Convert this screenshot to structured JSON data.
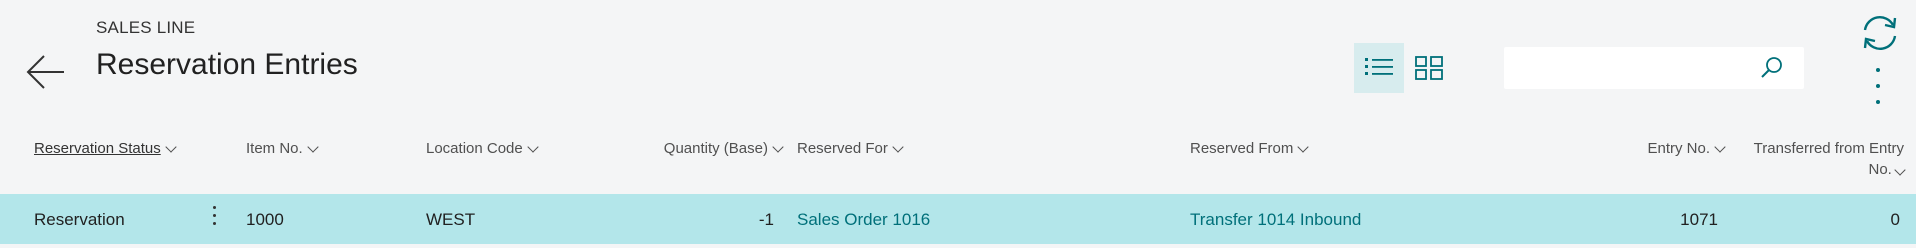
{
  "header": {
    "caption": "SALES LINE",
    "title": "Reservation Entries"
  },
  "search": {
    "value": "",
    "placeholder": ""
  },
  "columns": [
    {
      "label": "Reservation Status"
    },
    {
      "label": "Item No."
    },
    {
      "label": "Location Code"
    },
    {
      "label": "Quantity (Base)"
    },
    {
      "label": "Reserved For"
    },
    {
      "label": "Reserved From"
    },
    {
      "label": "Entry No."
    },
    {
      "label_line1": "Transferred from Entry",
      "label_line2": "No."
    }
  ],
  "rows": [
    {
      "reservation_status": "Reservation",
      "item_no": "1000",
      "location_code": "WEST",
      "quantity_base": "-1",
      "reserved_for": "Sales Order 1016",
      "reserved_from": "Transfer 1014 Inbound",
      "entry_no": "1071",
      "transferred_from_entry_no": "0"
    }
  ],
  "colors": {
    "accent": "#00707a",
    "selected_row": "#b3e6ea",
    "background": "#f4f5f6",
    "active_view": "#d7ecee"
  },
  "icons": {
    "back": "arrow-left-icon",
    "list_view": "list-view-icon",
    "tile_view": "tile-view-icon",
    "search": "search-icon",
    "refresh": "refresh-icon",
    "more": "more-vertical-icon"
  }
}
